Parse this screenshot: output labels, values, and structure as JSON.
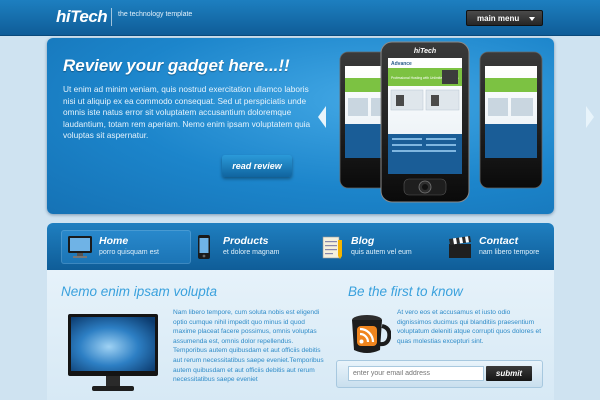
{
  "header": {
    "logo": "hiTech",
    "tagline": "the technology template",
    "menu_label": "main menu"
  },
  "hero": {
    "title": "Review your gadget here...!!",
    "body": "Ut enim ad minim veniam, quis nostrud exercitation ullamco laboris nisi ut aliquip ex ea commodo consequat. Sed ut perspiciatis unde omnis iste natus error sit voluptatem accusantium doloremque laudantium, totam rem aperiam. Nemo enim ipsam voluptatem quia voluptas sit aspernatur.",
    "button": "read review",
    "phone_brand": "hiTech",
    "phone_screen_heading": "Advance",
    "phone_banner": "Professional Hosting with Unlimited Features"
  },
  "nav": [
    {
      "title": "Home",
      "sub": "porro quisquam est",
      "icon": "desktop-icon"
    },
    {
      "title": "Products",
      "sub": "et dolore magnam",
      "icon": "phone-icon"
    },
    {
      "title": "Blog",
      "sub": "quis autem vel eum",
      "icon": "notepad-icon"
    },
    {
      "title": "Contact",
      "sub": "nam libero tempore",
      "icon": "clapperboard-icon"
    }
  ],
  "left_section": {
    "title": "Nemo enim ipsam volupta",
    "body": "Nam libero tempore, cum soluta nobis est eligendi optio cumque nihil impedit quo minus id quod maxime placeat facere possimus, omnis voluptas assumenda est, omnis dolor repellendus. Temporibus autem quibusdam et aut officiis debitis aut rerum necessitatibus saepe eveniet.Temporibus autem quibusdam et aut officiis debitis aut rerum necessitatibus saepe eveniet"
  },
  "right_section": {
    "title": "Be the first to know",
    "body": "At vero eos et accusamus et iusto odio dignissimos ducimus qui blanditiis praesentium voluptatum deleniti atque corrupti quos dolores et quas molestias excepturi sint.",
    "email_placeholder": "enter your email address",
    "submit_label": "submit"
  },
  "colors": {
    "accent": "#1c85cb",
    "heading": "#3aa1dd",
    "background": "#cfe3f1"
  }
}
